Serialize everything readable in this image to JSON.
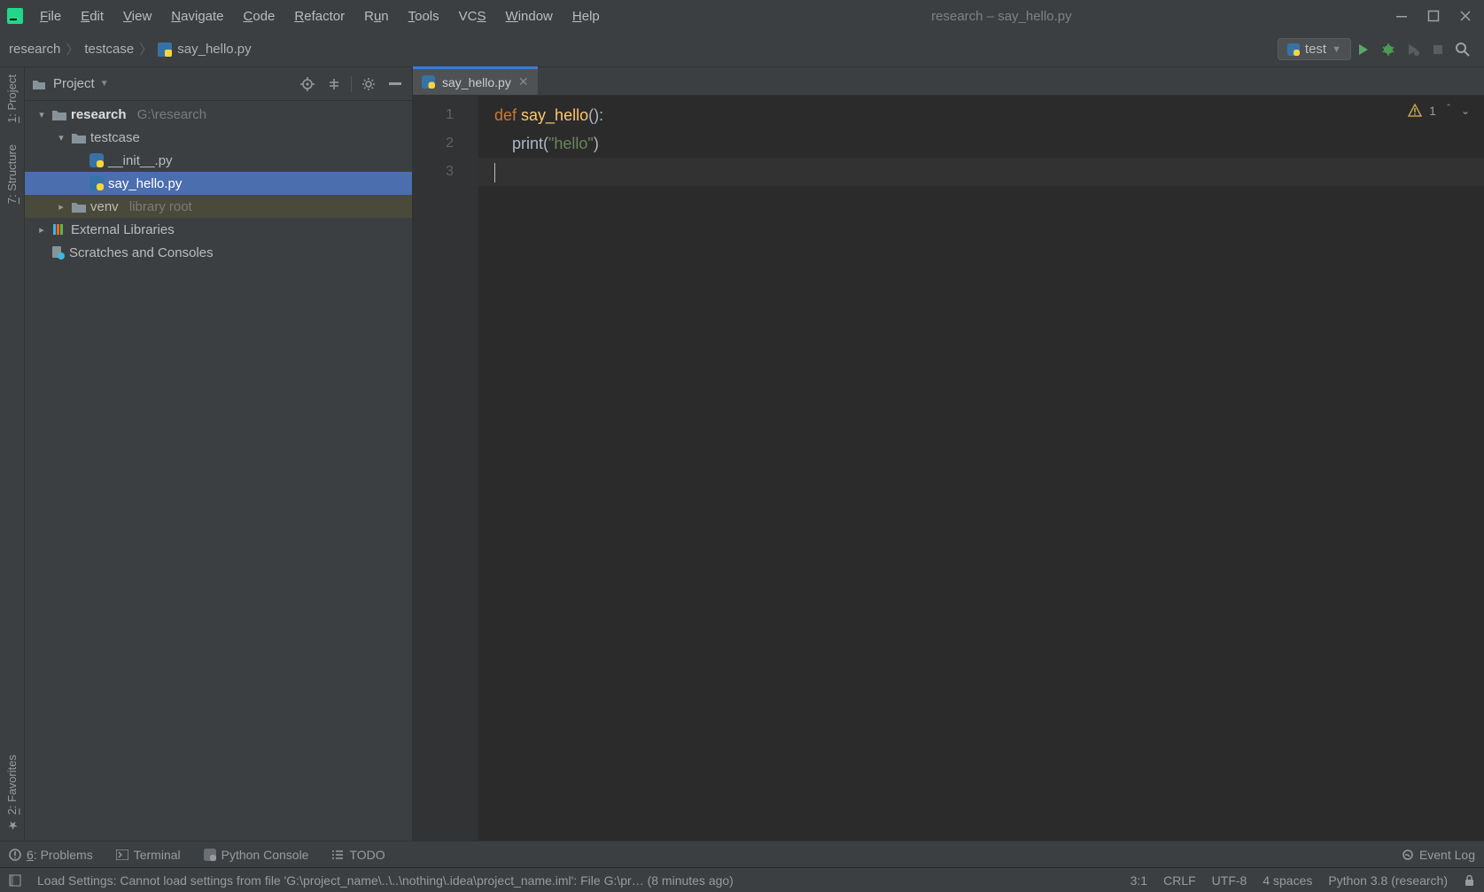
{
  "window": {
    "title": "research – say_hello.py"
  },
  "menubar": [
    "File",
    "Edit",
    "View",
    "Navigate",
    "Code",
    "Refactor",
    "Run",
    "Tools",
    "VCS",
    "Window",
    "Help"
  ],
  "breadcrumbs": {
    "items": [
      "research",
      "testcase",
      "say_hello.py"
    ]
  },
  "run_config": {
    "name": "test"
  },
  "project_panel": {
    "title": "Project"
  },
  "tree": {
    "root_name": "research",
    "root_path": "G:\\research",
    "testcase": "testcase",
    "init_py": "__init__.py",
    "say_hello": "say_hello.py",
    "venv": "venv",
    "venv_tag": "library root",
    "ext_lib": "External Libraries",
    "scratches": "Scratches and Consoles"
  },
  "left_tabs": {
    "project": "1: Project",
    "structure": "7: Structure",
    "favorites": "2: Favorites"
  },
  "editor": {
    "tab_label": "say_hello.py",
    "line_numbers": [
      "1",
      "2",
      "3"
    ],
    "code": {
      "l1_kw": "def ",
      "l1_fn": "say_hello",
      "l1_rest": "():",
      "l2_pre": "    print(",
      "l2_str": "\"hello\"",
      "l2_post": ")"
    },
    "inspection_count": "1"
  },
  "bottom_tabs": {
    "problems": "6: Problems",
    "terminal": "Terminal",
    "pyconsole": "Python Console",
    "todo": "TODO",
    "eventlog": "Event Log"
  },
  "status": {
    "message": "Load Settings: Cannot load settings from file 'G:\\project_name\\..\\..\\nothing\\.idea\\project_name.iml': File G:\\pr… (8 minutes ago)",
    "caret": "3:1",
    "line_sep": "CRLF",
    "encoding": "UTF-8",
    "indent": "4 spaces",
    "interpreter": "Python 3.8 (research)"
  }
}
